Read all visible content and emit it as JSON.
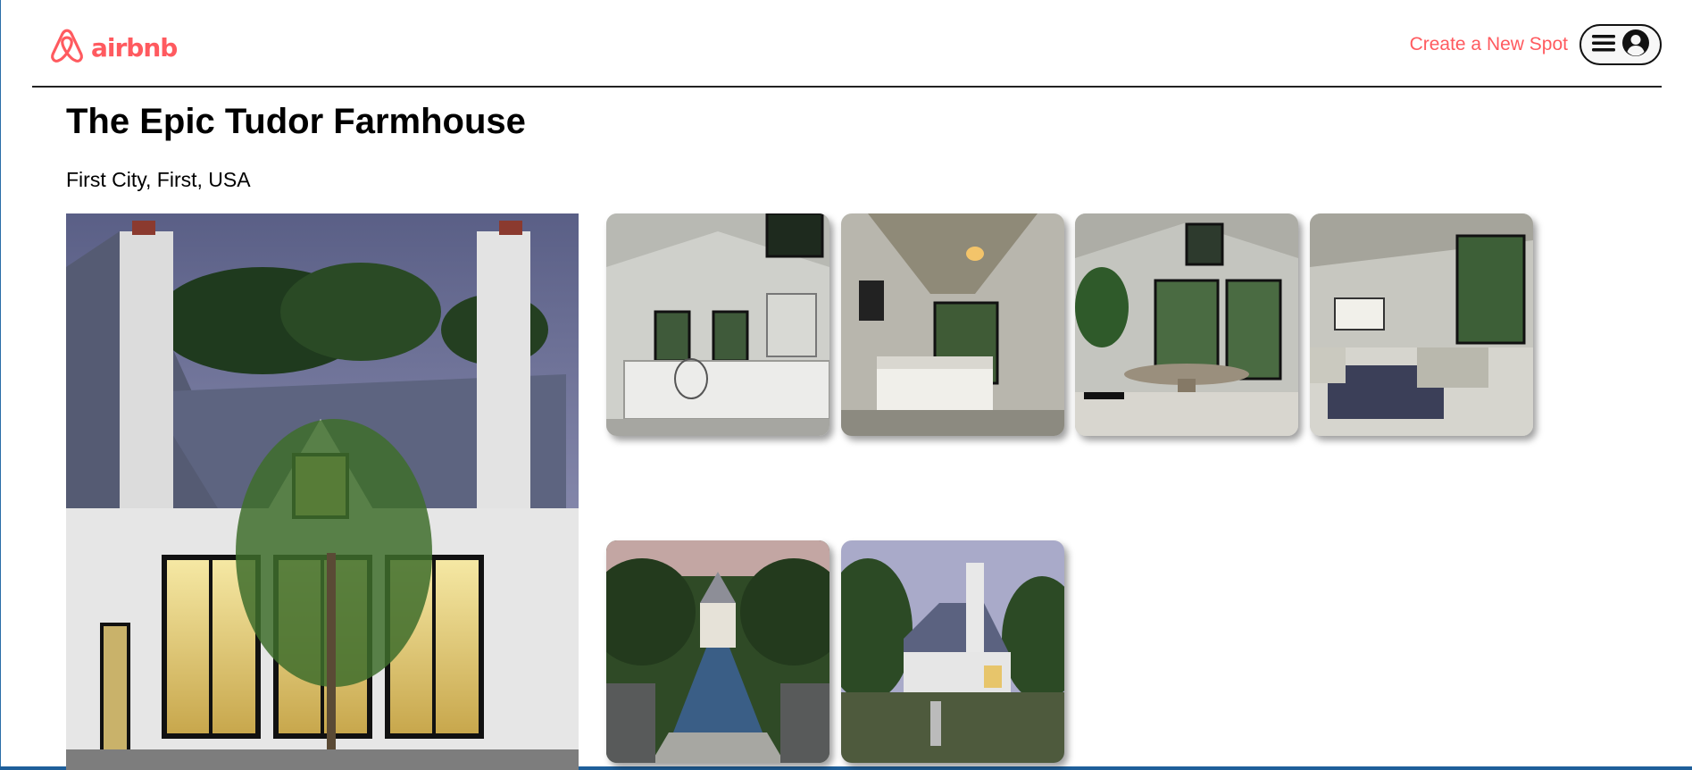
{
  "header": {
    "logo_text": "airbnb",
    "logo_icon": "airbnb-logo-icon",
    "create_spot_label": "Create a New Spot",
    "menu_icon": "hamburger-icon",
    "profile_icon": "user-circle-icon"
  },
  "spot": {
    "title": "The Epic Tudor Farmhouse",
    "location": "First City, First, USA"
  },
  "colors": {
    "brand": "#ff5a5f",
    "text": "#000000"
  }
}
